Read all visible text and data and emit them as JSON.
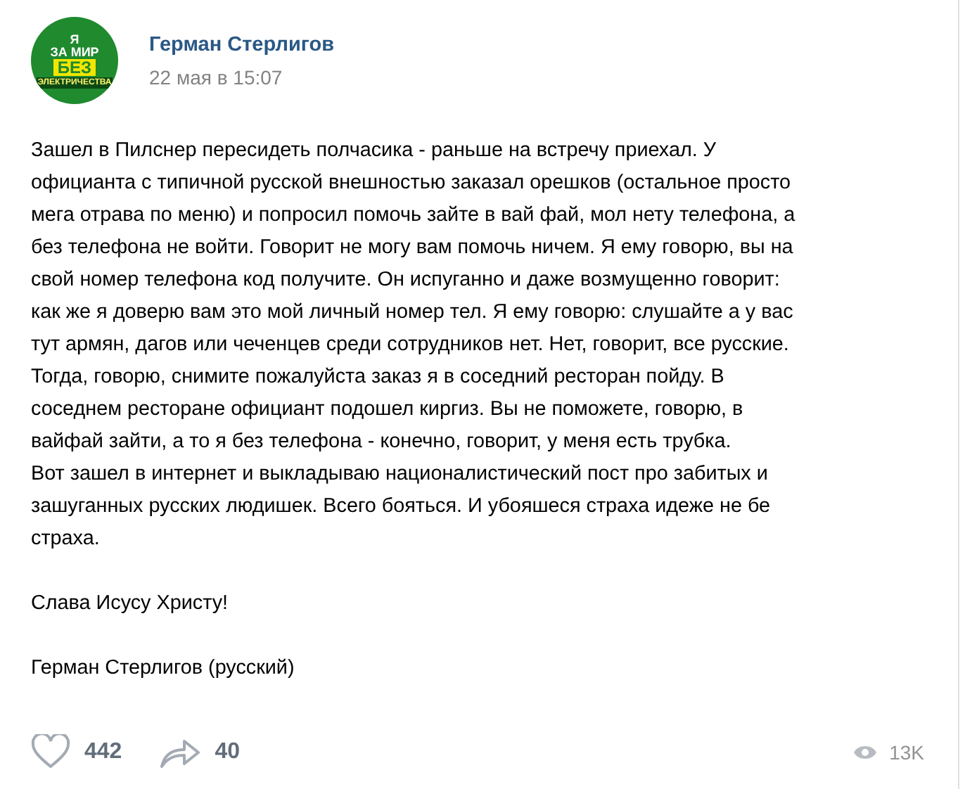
{
  "author": {
    "name": "Герман Стерлигов",
    "date": "22 мая в 15:07",
    "avatar_texts": [
      "Я",
      "ЗА МИР",
      "БЕЗ",
      "ЭЛЕКТРИЧЕСТВА"
    ]
  },
  "post": {
    "paragraphs": [
      "Зашел в Пилснер пересидеть полчасика - раньше на встречу приехал. У\nофицианта с типичной русской внешностью заказал орешков (остальное просто\nмега отрава по меню) и попросил помочь зайте в вай фай, мол нету телефона, а\nбез телефона не войти. Говорит не могу вам помочь ничем. Я ему говорю, вы на\nсвой номер телефона код получите. Он испуганно и даже возмущенно говорит:\nкак же я доверю вам это мой личный номер тел. Я ему говорю: слушайте а у вас\nтут армян, дагов или чеченцев среди сотрудников нет. Нет, говорит, все русские.\nТогда, говорю, снимите пожалуйста заказ я в соседний ресторан пойду. В\nсоседнем ресторане официант подошел киргиз. Вы не поможете, говорю, в\nвайфай зайти, а то я без телефона - конечно, говорит, у меня есть трубка.\nВот зашел в интернет и выкладываю националистический пост про забитых и\nзашуганных русских людишек. Всего бояться. И убояшеся страха идеже не бе\nстраха.",
      "Слава Исусу Христу!",
      "Герман Стерлигов (русский)"
    ]
  },
  "footer": {
    "likes": "442",
    "shares": "40",
    "views": "13K"
  }
}
